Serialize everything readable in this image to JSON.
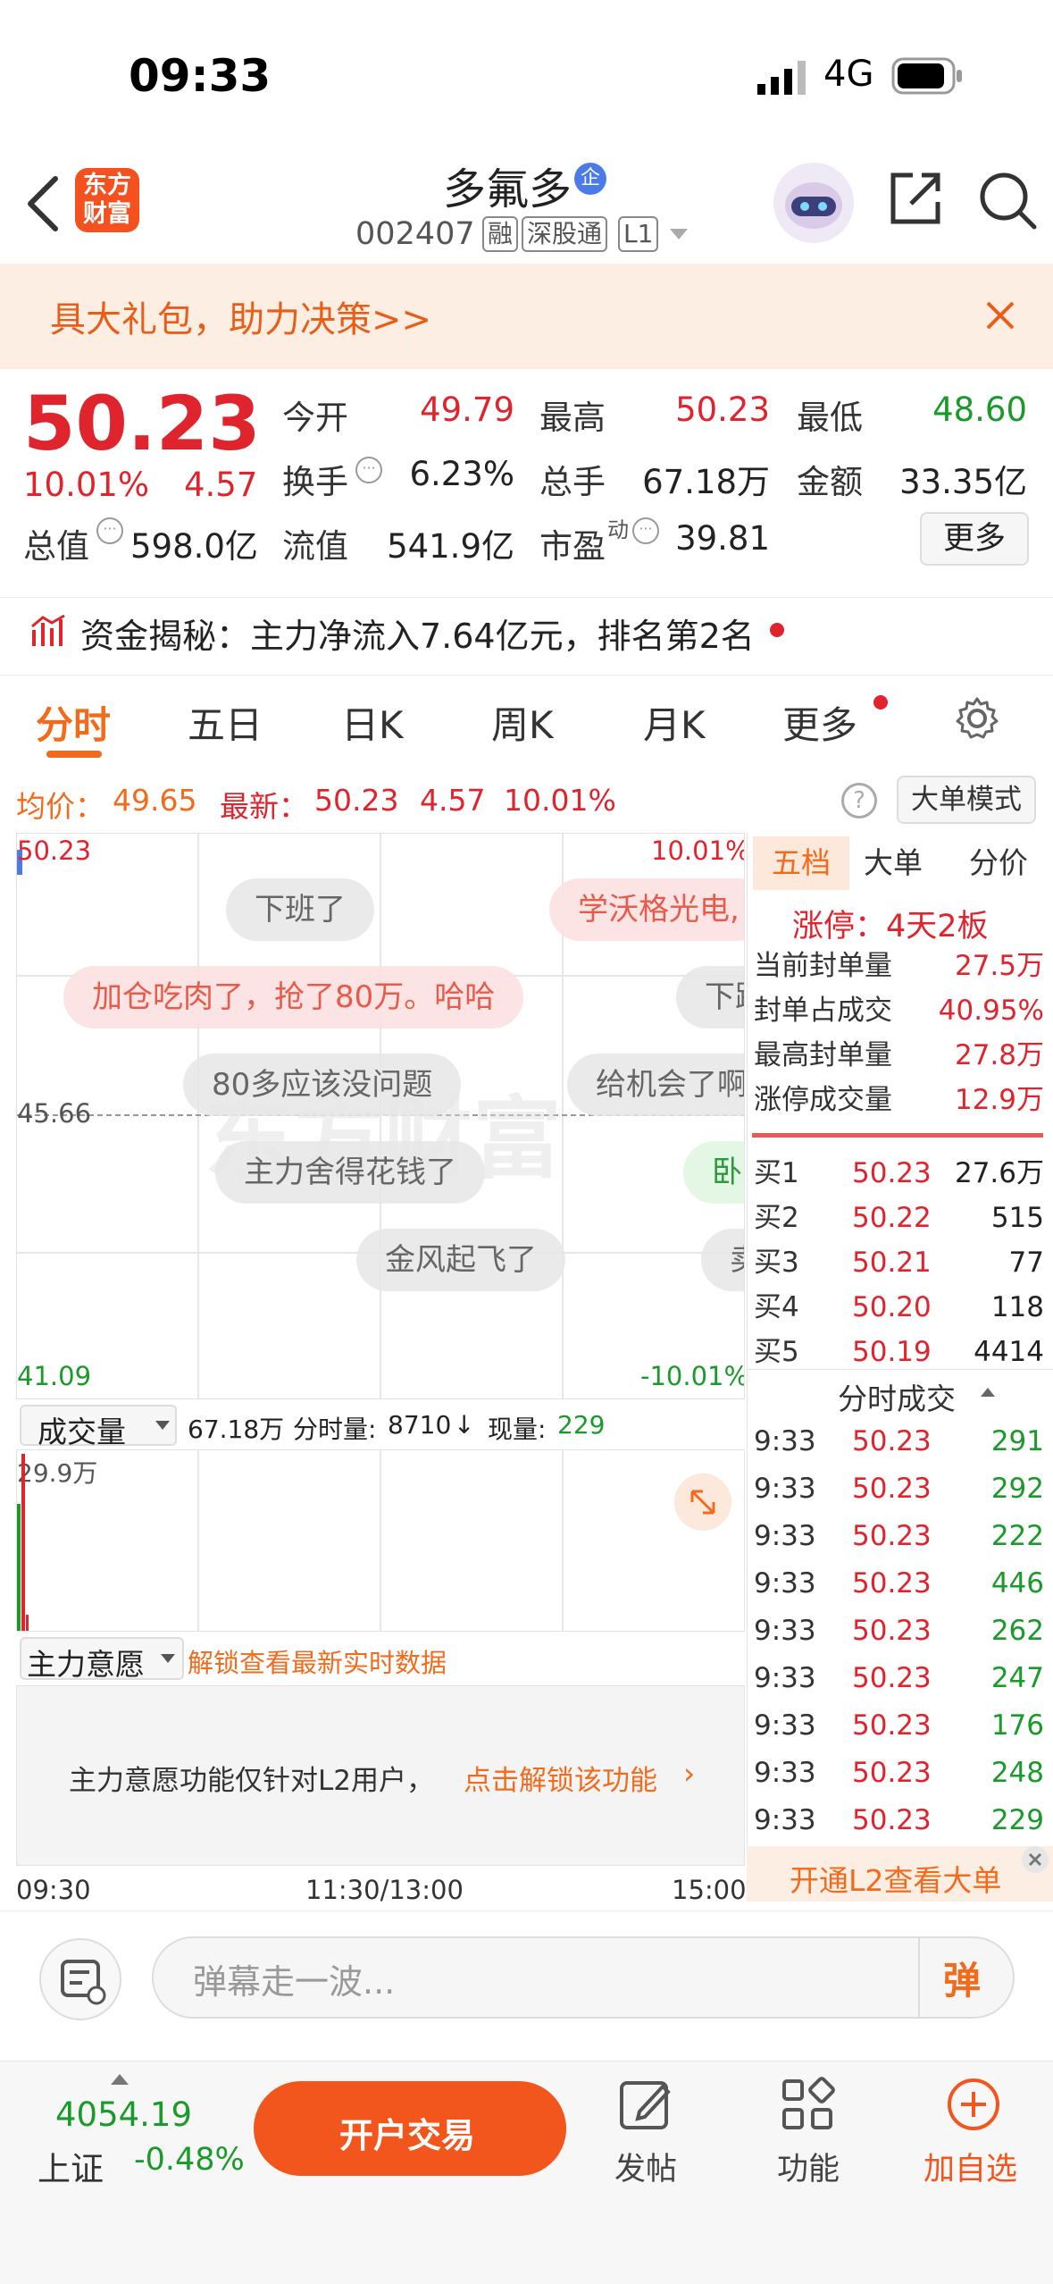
{
  "status_bar": {
    "time": "09:33",
    "network": "4G"
  },
  "header": {
    "stock_name": "多氟多",
    "corp_badge": "企",
    "stock_code": "002407",
    "tags": [
      "融",
      "深股通",
      "L1"
    ],
    "logo_text": "东方财富"
  },
  "banner": {
    "text": "具大礼包，助力决策>>"
  },
  "quote": {
    "price": "50.23",
    "change_pct": "10.01%",
    "change": "4.57",
    "fields": [
      {
        "label": "今开",
        "value": "49.79"
      },
      {
        "label": "最高",
        "value": "50.23"
      },
      {
        "label": "最低",
        "value": "48.60"
      },
      {
        "label": "换手",
        "value": "6.23%"
      },
      {
        "label": "总手",
        "value": "67.18万"
      },
      {
        "label": "金额",
        "value": "33.35亿"
      },
      {
        "label": "总值",
        "value": "598.0亿"
      },
      {
        "label": "流值",
        "value": "541.9亿"
      },
      {
        "label": "市盈",
        "value": "39.81"
      }
    ],
    "pe_sup": "动",
    "more_button": "更多"
  },
  "fund_flow": {
    "text": "资金揭秘：主力净流入7.64亿元，排名第2名"
  },
  "tabs": [
    "分时",
    "五日",
    "日K",
    "周K",
    "月K",
    "更多"
  ],
  "chart_header": {
    "avg_label": "均价：",
    "avg_value": "49.65",
    "latest_label": "最新：",
    "latest_value": "50.23",
    "change": "4.57",
    "change_pct": "10.01%",
    "mode_button": "大单模式"
  },
  "chart": {
    "y_top": "50.23",
    "y_mid": "45.66",
    "y_bot": "41.09",
    "pct_top": "10.01%",
    "pct_bot": "-10.01%",
    "x_start": "09:30",
    "x_mid": "11:30/13:00",
    "x_end": "15:00"
  },
  "danmu": [
    "下班了",
    "学沃格光电,",
    "加仓吃肉了，抢了80万。哈哈",
    "下跌",
    "80多应该没问题",
    "给机会了啊",
    "主力舍得花钱了",
    "卧",
    "金风起飞了",
    "卖"
  ],
  "volume": {
    "label": "成交量",
    "total": "67.18万",
    "fen_label": "分时量:",
    "fen_value": "8710",
    "arrow": "↓",
    "now_label": "现量:",
    "now_value": "229",
    "max": "29.9万"
  },
  "main_intent": {
    "label": "主力意愿",
    "unlock_link": "解锁查看最新实时数据",
    "notice": "主力意愿功能仅针对L2用户，",
    "notice_link": "点击解锁该功能"
  },
  "right_panel": {
    "tabs": [
      "五档",
      "大单",
      "分价"
    ],
    "limit_text": "涨停：4天2板",
    "stats": [
      {
        "label": "当前封单量",
        "value": "27.5万"
      },
      {
        "label": "封单占成交",
        "value": "40.95%"
      },
      {
        "label": "最高封单量",
        "value": "27.8万"
      },
      {
        "label": "涨停成交量",
        "value": "12.9万"
      }
    ],
    "bids": [
      {
        "label": "买1",
        "price": "50.23",
        "vol": "27.6万"
      },
      {
        "label": "买2",
        "price": "50.22",
        "vol": "515"
      },
      {
        "label": "买3",
        "price": "50.21",
        "vol": "77"
      },
      {
        "label": "买4",
        "price": "50.20",
        "vol": "118"
      },
      {
        "label": "买5",
        "price": "50.19",
        "vol": "4414"
      }
    ],
    "trades_title": "分时成交",
    "trades": [
      {
        "t": "9:33",
        "p": "50.23",
        "v": "291"
      },
      {
        "t": "9:33",
        "p": "50.23",
        "v": "292"
      },
      {
        "t": "9:33",
        "p": "50.23",
        "v": "222"
      },
      {
        "t": "9:33",
        "p": "50.23",
        "v": "446"
      },
      {
        "t": "9:33",
        "p": "50.23",
        "v": "262"
      },
      {
        "t": "9:33",
        "p": "50.23",
        "v": "247"
      },
      {
        "t": "9:33",
        "p": "50.23",
        "v": "176"
      },
      {
        "t": "9:33",
        "p": "50.23",
        "v": "248"
      },
      {
        "t": "9:33",
        "p": "50.23",
        "v": "229"
      }
    ],
    "l2_button": "开通L2查看大单"
  },
  "comment_bar": {
    "placeholder": "弹幕走一波...",
    "danmu_button": "弹"
  },
  "bottom": {
    "index_value": "4054.19",
    "index_name": "上证",
    "index_change": "-0.48%",
    "trade_button": "开户交易",
    "items": [
      "发帖",
      "功能",
      "加自选"
    ]
  }
}
